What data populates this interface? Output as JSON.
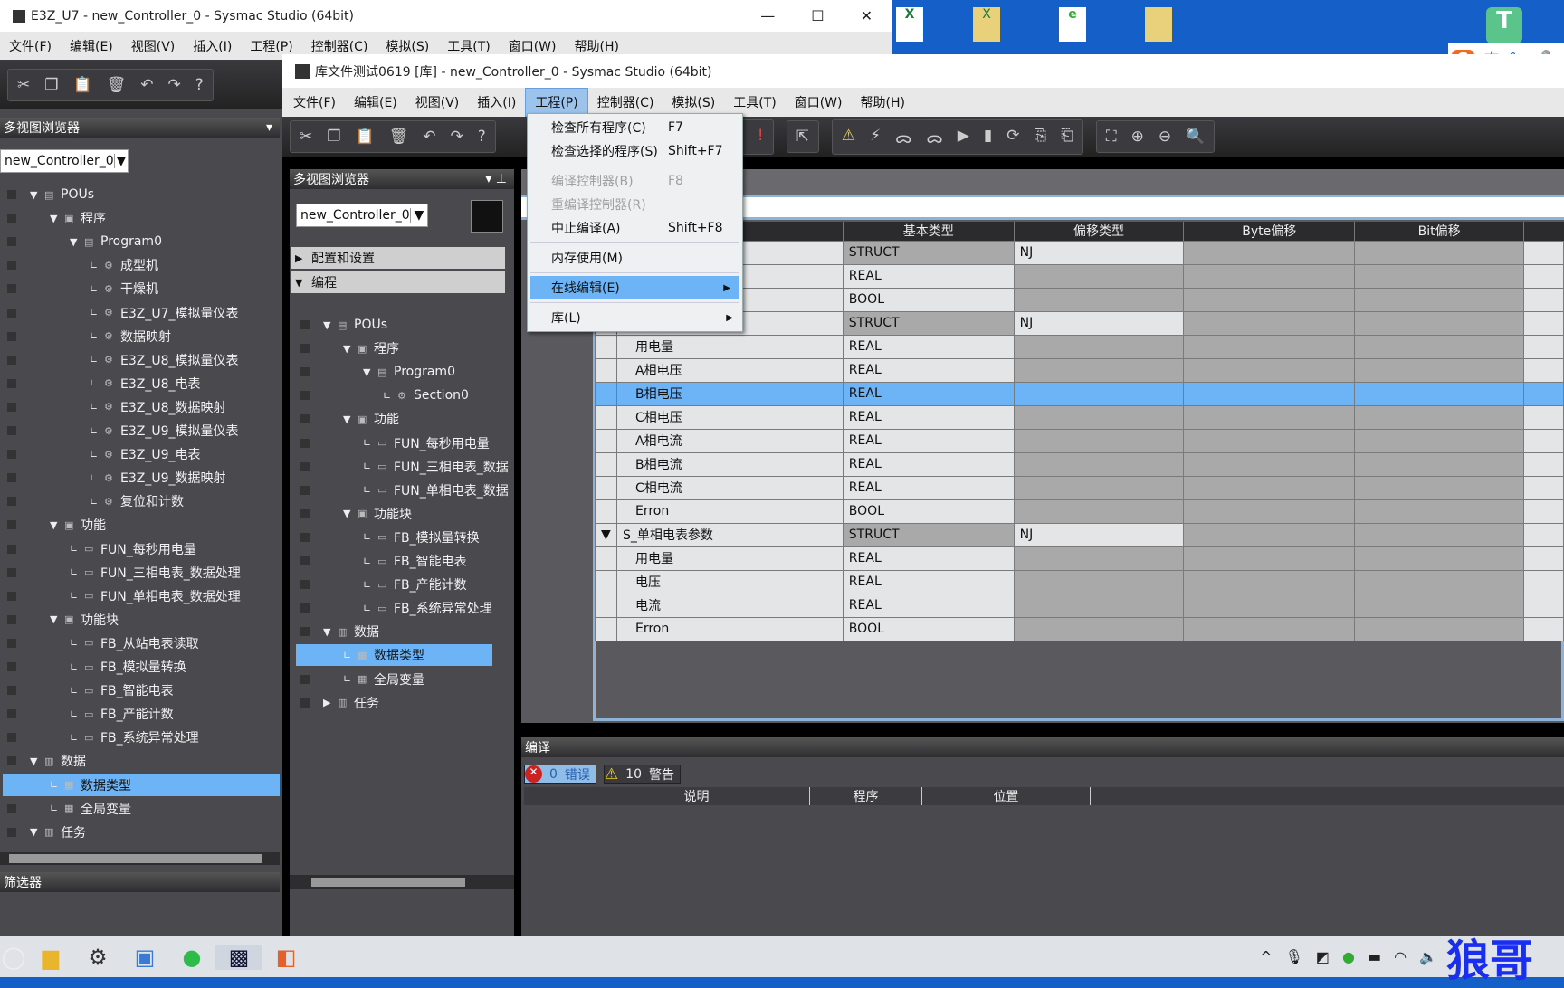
{
  "back_window": {
    "title": "E3Z_U7 - new_Controller_0 - Sysmac Studio (64bit)",
    "menus": [
      "文件(F)",
      "编辑(E)",
      "视图(V)",
      "插入(I)",
      "工程(P)",
      "控制器(C)",
      "模拟(S)",
      "工具(T)",
      "窗口(W)",
      "帮助(H)"
    ],
    "panel_title": "多视图浏览器",
    "controller": "new_Controller_0",
    "tree": [
      {
        "label": "POUs",
        "depth": 0,
        "toggle": "▼",
        "icon": "▤"
      },
      {
        "label": "程序",
        "depth": 1,
        "toggle": "▼",
        "icon": "▣"
      },
      {
        "label": "Program0",
        "depth": 2,
        "toggle": "▼",
        "icon": "▤"
      },
      {
        "label": "成型机",
        "depth": 3,
        "icon": "⚙"
      },
      {
        "label": "干燥机",
        "depth": 3,
        "icon": "⚙"
      },
      {
        "label": "E3Z_U7_模拟量仪表",
        "depth": 3,
        "icon": "⚙"
      },
      {
        "label": "数据映射",
        "depth": 3,
        "icon": "⚙"
      },
      {
        "label": "E3Z_U8_模拟量仪表",
        "depth": 3,
        "icon": "⚙"
      },
      {
        "label": "E3Z_U8_电表",
        "depth": 3,
        "icon": "⚙"
      },
      {
        "label": "E3Z_U8_数据映射",
        "depth": 3,
        "icon": "⚙"
      },
      {
        "label": "E3Z_U9_模拟量仪表",
        "depth": 3,
        "icon": "⚙"
      },
      {
        "label": "E3Z_U9_电表",
        "depth": 3,
        "icon": "⚙"
      },
      {
        "label": "E3Z_U9_数据映射",
        "depth": 3,
        "icon": "⚙"
      },
      {
        "label": "复位和计数",
        "depth": 3,
        "icon": "⚙"
      },
      {
        "label": "功能",
        "depth": 1,
        "toggle": "▼",
        "icon": "▣"
      },
      {
        "label": "FUN_每秒用电量",
        "depth": 2,
        "icon": "▭"
      },
      {
        "label": "FUN_三相电表_数据处理",
        "depth": 2,
        "icon": "▭"
      },
      {
        "label": "FUN_单相电表_数据处理",
        "depth": 2,
        "icon": "▭"
      },
      {
        "label": "功能块",
        "depth": 1,
        "toggle": "▼",
        "icon": "▣"
      },
      {
        "label": "FB_从站电表读取",
        "depth": 2,
        "icon": "▭"
      },
      {
        "label": "FB_模拟量转换",
        "depth": 2,
        "icon": "▭"
      },
      {
        "label": "FB_智能电表",
        "depth": 2,
        "icon": "▭"
      },
      {
        "label": "FB_产能计数",
        "depth": 2,
        "icon": "▭"
      },
      {
        "label": "FB_系统异常处理",
        "depth": 2,
        "icon": "▭"
      },
      {
        "label": "数据",
        "depth": 0,
        "toggle": "▼",
        "icon": "▥"
      },
      {
        "label": "数据类型",
        "depth": 1,
        "icon": "▦",
        "selected": true
      },
      {
        "label": "全局变量",
        "depth": 1,
        "icon": "▦"
      },
      {
        "label": "任务",
        "depth": 0,
        "toggle": "▼",
        "icon": "▥"
      }
    ],
    "filter_label": "筛选器"
  },
  "front_window": {
    "title": "库文件测试0619 [库] - new_Controller_0 - Sysmac Studio (64bit)",
    "menus": [
      "文件(F)",
      "编辑(E)",
      "视图(V)",
      "插入(I)",
      "工程(P)",
      "控制器(C)",
      "模拟(S)",
      "工具(T)",
      "窗口(W)",
      "帮助(H)"
    ],
    "active_menu": 4,
    "panel_title": "多视图浏览器",
    "controller": "new_Controller_0",
    "sections": [
      "配置和设置",
      "编程"
    ],
    "tree": [
      {
        "label": "POUs",
        "depth": 0,
        "toggle": "▼",
        "icon": "▤"
      },
      {
        "label": "程序",
        "depth": 1,
        "toggle": "▼",
        "icon": "▣"
      },
      {
        "label": "Program0",
        "depth": 2,
        "toggle": "▼",
        "icon": "▤"
      },
      {
        "label": "Section0",
        "depth": 3,
        "icon": "⚙"
      },
      {
        "label": "功能",
        "depth": 1,
        "toggle": "▼",
        "icon": "▣"
      },
      {
        "label": "FUN_每秒用电量",
        "depth": 2,
        "icon": "▭"
      },
      {
        "label": "FUN_三相电表_数据",
        "depth": 2,
        "icon": "▭"
      },
      {
        "label": "FUN_单相电表_数据",
        "depth": 2,
        "icon": "▭"
      },
      {
        "label": "功能块",
        "depth": 1,
        "toggle": "▼",
        "icon": "▣"
      },
      {
        "label": "FB_模拟量转换",
        "depth": 2,
        "icon": "▭"
      },
      {
        "label": "FB_智能电表",
        "depth": 2,
        "icon": "▭"
      },
      {
        "label": "FB_产能计数",
        "depth": 2,
        "icon": "▭"
      },
      {
        "label": "FB_系统异常处理",
        "depth": 2,
        "icon": "▭"
      },
      {
        "label": "数据",
        "depth": 0,
        "toggle": "▼",
        "icon": "▥"
      },
      {
        "label": "数据类型",
        "depth": 1,
        "icon": "▦",
        "selected": true
      },
      {
        "label": "全局变量",
        "depth": 1,
        "icon": "▦"
      },
      {
        "label": "任务",
        "depth": 0,
        "toggle": "▶",
        "icon": "▥"
      }
    ],
    "table": {
      "columns": [
        "",
        "基本类型",
        "偏移类型",
        "Byte偏移",
        "Bit偏移"
      ],
      "rows": [
        {
          "name": "",
          "type": "STRUCT",
          "offset": "NJ"
        },
        {
          "name": "",
          "type": "REAL",
          "offset": ""
        },
        {
          "name": "",
          "type": "BOOL",
          "offset": ""
        },
        {
          "name": "",
          "type": "STRUCT",
          "offset": "NJ"
        },
        {
          "name": "用电量",
          "type": "REAL",
          "offset": ""
        },
        {
          "name": "A相电压",
          "type": "REAL",
          "offset": ""
        },
        {
          "name": "B相电压",
          "type": "REAL",
          "offset": "",
          "selected": true
        },
        {
          "name": "C相电压",
          "type": "REAL",
          "offset": ""
        },
        {
          "name": "A相电流",
          "type": "REAL",
          "offset": ""
        },
        {
          "name": "B相电流",
          "type": "REAL",
          "offset": ""
        },
        {
          "name": "C相电流",
          "type": "REAL",
          "offset": ""
        },
        {
          "name": "Erron",
          "type": "BOOL",
          "offset": ""
        },
        {
          "name": "S_单相电表参数",
          "type": "STRUCT",
          "offset": "NJ",
          "toggle": "▼"
        },
        {
          "name": "用电量",
          "type": "REAL",
          "offset": ""
        },
        {
          "name": "电压",
          "type": "REAL",
          "offset": ""
        },
        {
          "name": "电流",
          "type": "REAL",
          "offset": ""
        },
        {
          "name": "Erron",
          "type": "BOOL",
          "offset": ""
        }
      ]
    },
    "project_menu": [
      {
        "label": "检查所有程序(C)",
        "shortcut": "F7"
      },
      {
        "label": "检查选择的程序(S)",
        "shortcut": "Shift+F7"
      },
      {
        "sep": true
      },
      {
        "label": "编译控制器(B)",
        "shortcut": "F8",
        "disabled": true
      },
      {
        "label": "重编译控制器(R)",
        "disabled": true
      },
      {
        "label": "中止编译(A)",
        "shortcut": "Shift+F8"
      },
      {
        "sep": true
      },
      {
        "label": "内存使用(M)"
      },
      {
        "sep": true
      },
      {
        "label": "在线编辑(E)",
        "submenu": true,
        "highlighted": true
      },
      {
        "sep": true
      },
      {
        "label": "库(L)",
        "submenu": true
      }
    ],
    "build_panel": {
      "title": "编译",
      "errors": "0",
      "errors_label": "错误",
      "warnings": "10",
      "warnings_label": "警告",
      "columns": [
        "",
        "",
        "说明",
        "程序",
        "位置"
      ]
    }
  },
  "ime": {
    "mode": "中"
  },
  "watermark": "狼哥",
  "colors": {
    "selection": "#6cb4f5",
    "desktop": "#1560c8"
  }
}
